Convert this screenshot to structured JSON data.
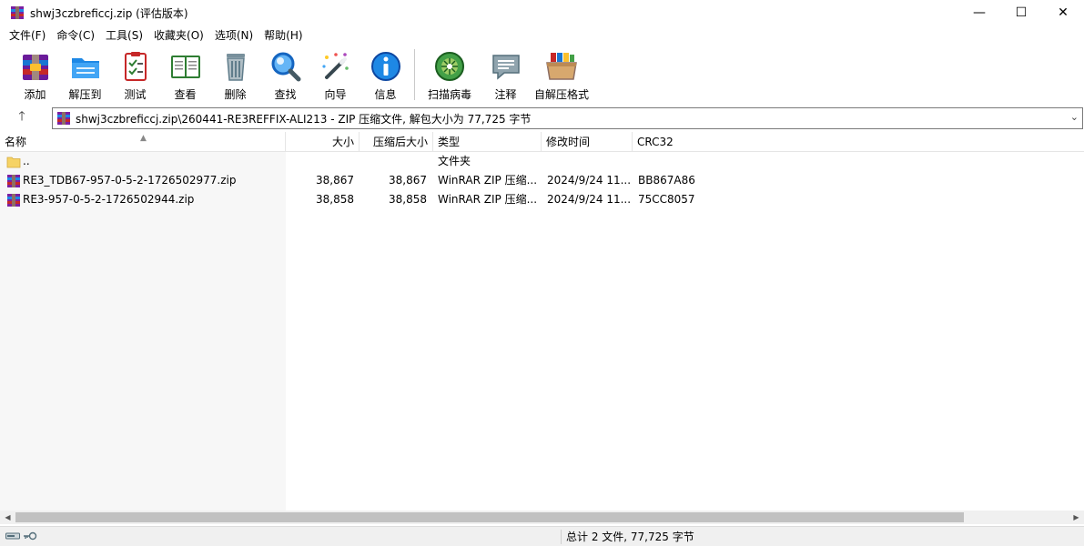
{
  "window": {
    "title": "shwj3czbreficcj.zip (评估版本)",
    "minimize": "—",
    "maximize": "☐",
    "close": "✕"
  },
  "menu": [
    "文件(F)",
    "命令(C)",
    "工具(S)",
    "收藏夹(O)",
    "选项(N)",
    "帮助(H)"
  ],
  "toolbar": {
    "add": "添加",
    "extract": "解压到",
    "test": "测试",
    "view": "查看",
    "delete": "删除",
    "find": "查找",
    "wizard": "向导",
    "info": "信息",
    "scan": "扫描病毒",
    "comment": "注释",
    "sfx": "自解压格式"
  },
  "address": {
    "up": "🡑",
    "path": "shwj3czbreficcj.zip\\260441-RE3REFFIX-ALI213 - ZIP 压缩文件, 解包大小为 77,725 字节",
    "dropdown": "⌄"
  },
  "columns": {
    "name": "名称",
    "size": "大小",
    "packed": "压缩后大小",
    "type": "类型",
    "modified": "修改时间",
    "crc": "CRC32"
  },
  "rows": [
    {
      "name": "..",
      "size": "",
      "packed": "",
      "type": "文件夹",
      "modified": "",
      "crc": ""
    },
    {
      "name": "RE3_TDB67-957-0-5-2-1726502977.zip",
      "size": "38,867",
      "packed": "38,867",
      "type": "WinRAR ZIP 压缩...",
      "modified": "2024/9/24 11...",
      "crc": "BB867A86"
    },
    {
      "name": "RE3-957-0-5-2-1726502944.zip",
      "size": "38,858",
      "packed": "38,858",
      "type": "WinRAR ZIP 压缩...",
      "modified": "2024/9/24 11...",
      "crc": "75CC8057"
    }
  ],
  "status": {
    "summary": "总计 2 文件, 77,725 字节"
  },
  "colors": {
    "accent_red": "#c62828",
    "rar_purple": "#5e35b1",
    "folder_yellow": "#f6d365"
  }
}
